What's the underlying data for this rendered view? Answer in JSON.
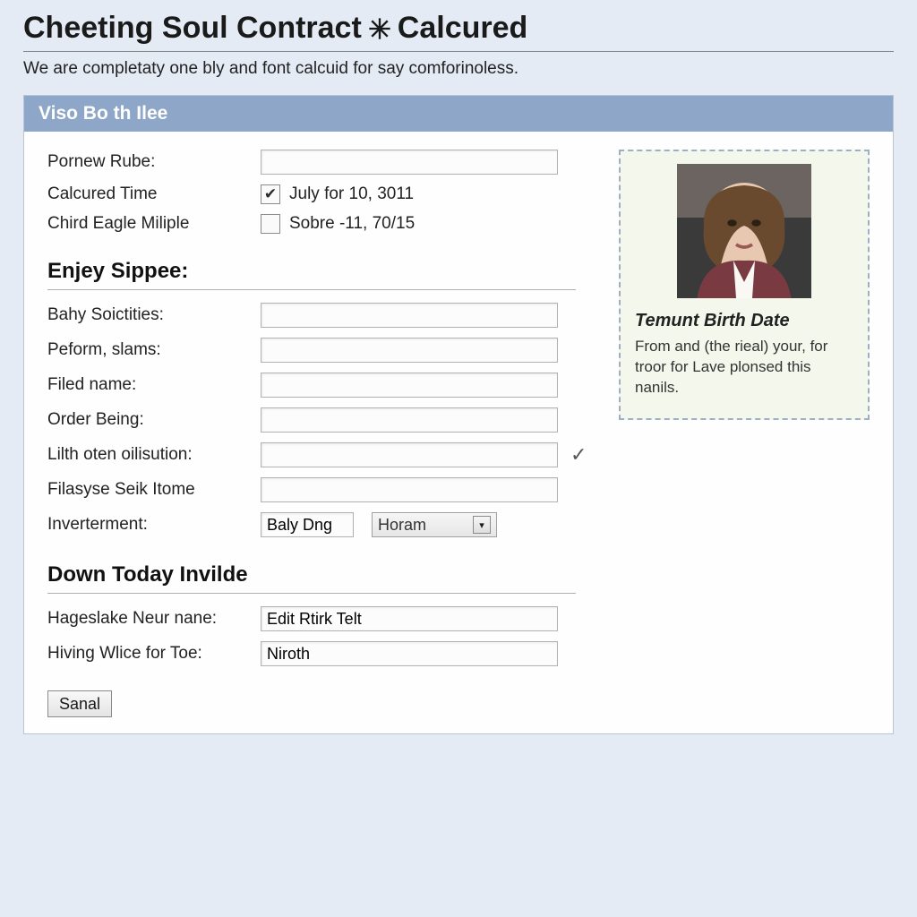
{
  "title_part1": "Cheeting Soul Contract",
  "title_part2": " Calcured",
  "subtitle": "We are completaty one bly and font calcuid for say comforinoless.",
  "panel_header": "Viso Bo th Ilee",
  "top_form": {
    "row1_label": "Pornew Rube:",
    "row1_value": "",
    "row2_label": "Calcured Time",
    "row2_checked": true,
    "row2_text": "July for 10, 3011",
    "row3_label": "Chird Eagle Miliple",
    "row3_checked": false,
    "row3_text": "Sobre -11, 70/15"
  },
  "section2_heading": "Enjey Sippee:",
  "section2": {
    "r1_label": "Bahy Soictities:",
    "r1_value": "",
    "r2_label": "Peform, slams:",
    "r2_value": "",
    "r3_label": "Filed name:",
    "r3_value": "",
    "r4_label": "Order Being:",
    "r4_value": "",
    "r5_label": "Lilth oten oilisution:",
    "r5_value": "",
    "r6_label": "Filasyse Seik Itome",
    "r6_value": "",
    "r7_label": "Inverterment:",
    "r7_input_value": "Baly Dng",
    "r7_select_text": "Horam"
  },
  "section3_heading": "Down Today Invilde",
  "section3": {
    "r1_label": "Hageslake Neur nane:",
    "r1_value": "Edit Rtirk Telt",
    "r2_label": "Hiving Wlice for Toe:",
    "r2_value": "Niroth"
  },
  "submit_label": "Sanal",
  "side": {
    "title": "Temunt Birth Date",
    "body": "From and (the rieal) your, for troor for Lave plonsed this nanils."
  },
  "colors": {
    "page_bg": "#e4ebf5",
    "panel_header_bg": "#8ea6c7",
    "side_card_bg": "#f4f7ec",
    "side_card_border": "#9cafc4"
  }
}
